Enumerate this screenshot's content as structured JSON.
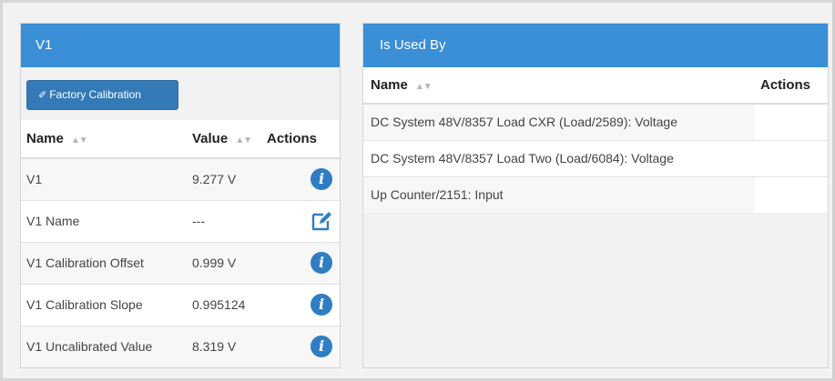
{
  "left_panel": {
    "title": "V1",
    "factory_button_label": "Factory Calibration",
    "columns": {
      "name": "Name",
      "value": "Value",
      "actions": "Actions"
    },
    "rows": [
      {
        "name": "V1",
        "value": "9.277 V",
        "action_icon": "info-icon"
      },
      {
        "name": "V1 Name",
        "value": "---",
        "action_icon": "edit-icon"
      },
      {
        "name": "V1 Calibration Offset",
        "value": "0.999 V",
        "action_icon": "info-icon"
      },
      {
        "name": "V1 Calibration Slope",
        "value": "0.995124",
        "action_icon": "info-icon"
      },
      {
        "name": "V1 Uncalibrated Value",
        "value": "8.319 V",
        "action_icon": "info-icon"
      }
    ]
  },
  "right_panel": {
    "title": "Is Used By",
    "columns": {
      "name": "Name",
      "actions": "Actions"
    },
    "rows": [
      {
        "name": "DC System 48V/8357 Load CXR (Load/2589): Voltage"
      },
      {
        "name": "DC System 48V/8357 Load Two (Load/6084): Voltage"
      },
      {
        "name": "Up Counter/2151: Input"
      }
    ]
  },
  "colors": {
    "panel_heading": "#3a8fd6",
    "button": "#337ab7",
    "info_icon": "#2f7ec4"
  }
}
